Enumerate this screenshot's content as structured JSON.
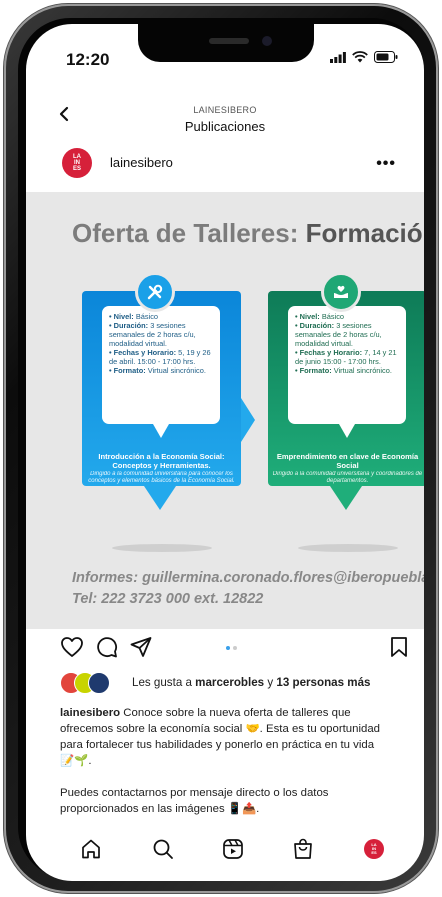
{
  "status_bar": {
    "time": "12:20"
  },
  "header": {
    "account_caps": "LAINESIBERO",
    "title": "Publicaciones"
  },
  "post": {
    "username": "lainesibero",
    "avatar_text": [
      "LA",
      "IN",
      "ES"
    ],
    "image": {
      "title_prefix": "Oferta de Talleres: ",
      "title_bold": "Formació",
      "cards": [
        {
          "color": "#1aa0e8",
          "icon": "tools-icon",
          "details": [
            {
              "label": "• Nivel:",
              "text": " Básico"
            },
            {
              "label": "• Duración:",
              "text": " 3 sesiones semanales de 2 horas c/u, modalidad virtual."
            },
            {
              "label": "• Fechas y Horario:",
              "text": " 5, 19 y 26 de abril. 15:00 - 17:00 hrs."
            },
            {
              "label": "• Formato:",
              "text": " Virtual sincrónico."
            }
          ],
          "footer_title": "Introducción a la Economía Social: Conceptos y Herramientas.",
          "footer_sub": "Dirigido a la comunidad universitaria para conocer los conceptos y elementos básicos de la Economía Social."
        },
        {
          "color": "#1fa775",
          "icon": "hands-heart-icon",
          "details": [
            {
              "label": "• Nivel:",
              "text": " Básico"
            },
            {
              "label": "• Duración:",
              "text": " 3 sesiones semanales de 2 horas c/u, modalidad virtual."
            },
            {
              "label": "• Fechas y Horario:",
              "text": " 7, 14 y 21 de junio 15:00 - 17:00 hrs."
            },
            {
              "label": "• Formato:",
              "text": " Virtual sincrónico."
            }
          ],
          "footer_title": "Emprendimiento en clave de Economía Social",
          "footer_sub": "Dirigido a la comunidad universitaria y coordinadores de departamentos."
        }
      ],
      "informes": "Informes: guillermina.coronado.flores@iberopuebla.mx",
      "tel": "Tel: 222 3723 000 ext. 12822"
    },
    "carousel": {
      "total": 2,
      "active": 1
    },
    "likes": {
      "avatar_colors": [
        "#e2453c",
        "#c8d400",
        "#1f3a6e"
      ],
      "prefix": "Les gusta a ",
      "user": "marcerobles",
      "middle": " y ",
      "others": "13 personas más"
    },
    "caption": {
      "username": "lainesibero",
      "paragraph1": " Conoce sobre la nueva oferta de talleres que ofrecemos sobre la economía social 🤝. Esta es tu oportunidad para fortalecer tus habilidades y ponerlo en práctica en tu vida 📝🌱.",
      "paragraph2": "Puedes contactarnos por mensaje directo o los datos proporcionados en las imágenes 📱📤."
    }
  },
  "tab_bar": {
    "items": [
      "home-icon",
      "search-icon",
      "reels-icon",
      "shop-icon",
      "profile-avatar"
    ],
    "profile_text": [
      "LA",
      "IN",
      "ES"
    ]
  },
  "colors": {
    "brand_red": "#d6203a",
    "accent_blue": "#3aa0ea"
  }
}
